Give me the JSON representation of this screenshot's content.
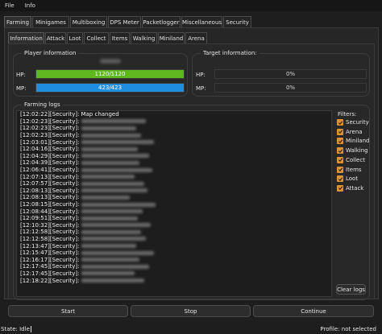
{
  "menu": [
    "File",
    "Info"
  ],
  "outer_tabs": [
    "Farming",
    "Minigames",
    "Multiboxing",
    "DPS Meter",
    "Packetlogger",
    "Miscellaneous",
    "Security"
  ],
  "outer_active": "Farming",
  "inner_tabs": [
    "Information",
    "Attack",
    "Loot",
    "Collect",
    "Items",
    "Walking",
    "Miniland",
    "Arena"
  ],
  "inner_active": "Information",
  "player": {
    "title": "Player information",
    "hp_label": "HP:",
    "hp_text": "1120/1120",
    "hp_fraction": 1.0,
    "hp_color": "#5fb81f",
    "mp_label": "MP:",
    "mp_text": "423/423",
    "mp_fraction": 1.0,
    "mp_color": "#1f8ee0"
  },
  "target": {
    "title": "Target information:",
    "hp_label": "HP:",
    "hp_text": "0%",
    "mp_label": "MP:",
    "mp_text": "0%"
  },
  "logs": {
    "title": "Farming logs",
    "lines": [
      {
        "time": "[12:02:22][Security]:",
        "msg": "Map changed"
      },
      {
        "time": "[12:02:23][Security]:",
        "msg": ""
      },
      {
        "time": "[12:02:23][Security]:",
        "msg": ""
      },
      {
        "time": "[12:02:23][Security]:",
        "msg": ""
      },
      {
        "time": "[12:03:01][Security]:",
        "msg": ""
      },
      {
        "time": "[12:04:16][Security]:",
        "msg": ""
      },
      {
        "time": "[12:04:29][Security]:",
        "msg": ""
      },
      {
        "time": "[12:04:39][Security]:",
        "msg": ""
      },
      {
        "time": "[12:06:41][Security]:",
        "msg": ""
      },
      {
        "time": "[12:07:13][Security]:",
        "msg": ""
      },
      {
        "time": "[12:07:57][Security]:",
        "msg": ""
      },
      {
        "time": "[12:08:13][Security]:",
        "msg": ""
      },
      {
        "time": "[12:08:13][Security]:",
        "msg": ""
      },
      {
        "time": "[12:08:15][Security]:",
        "msg": ""
      },
      {
        "time": "[12:08:44][Security]:",
        "msg": ""
      },
      {
        "time": "[12:09:51][Security]:",
        "msg": ""
      },
      {
        "time": "[12:10:32][Security]:",
        "msg": ""
      },
      {
        "time": "[12:12:58][Security]:",
        "msg": ""
      },
      {
        "time": "[12:12:58][Security]:",
        "msg": ""
      },
      {
        "time": "[12:13:47][Security]:",
        "msg": ""
      },
      {
        "time": "[12:15:47][Security]:",
        "msg": ""
      },
      {
        "time": "[12:16:17][Security]:",
        "msg": ""
      },
      {
        "time": "[12:17:45][Security]:",
        "msg": ""
      },
      {
        "time": "[12:17:45][Security]:",
        "msg": ""
      },
      {
        "time": "[12:18:22][Security]:",
        "msg": ""
      }
    ]
  },
  "filters": {
    "title": "Filters:",
    "items": [
      "Security",
      "Arena",
      "Miniland",
      "Walking",
      "Collect",
      "Items",
      "Loot",
      "Attack"
    ],
    "checked_color": "#e0922e",
    "clear_label": "Clear logs"
  },
  "actions": {
    "start": "Start",
    "stop": "Stop",
    "continue": "Continue"
  },
  "status": {
    "state": "State: Idle",
    "profile": "Profile: not selected"
  }
}
